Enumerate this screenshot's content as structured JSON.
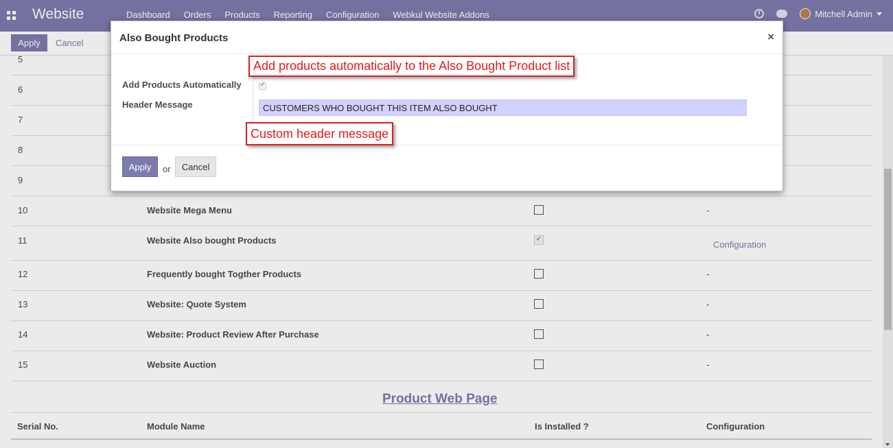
{
  "navbar": {
    "brand": "Website",
    "menu": [
      "Dashboard",
      "Orders",
      "Products",
      "Reporting",
      "Configuration",
      "Webkul Website Addons"
    ],
    "user": "Mitchell Admin"
  },
  "control_panel": {
    "apply_label": "Apply",
    "cancel_label": "Cancel"
  },
  "table": {
    "rows": [
      {
        "num": "5",
        "name": "",
        "installed": null,
        "config": ""
      },
      {
        "num": "6",
        "name": "",
        "installed": null,
        "config": ""
      },
      {
        "num": "7",
        "name": "",
        "installed": null,
        "config": ""
      },
      {
        "num": "8",
        "name": "",
        "installed": null,
        "config": ""
      },
      {
        "num": "9",
        "name": "",
        "installed": null,
        "config": ""
      },
      {
        "num": "10",
        "name": "Website Mega Menu",
        "installed": false,
        "config": "-"
      },
      {
        "num": "11",
        "name": "Website Also bought Products",
        "installed": true,
        "config": "Configuration"
      },
      {
        "num": "12",
        "name": "Frequently bought Togther Products",
        "installed": false,
        "config": "-"
      },
      {
        "num": "13",
        "name": "Website: Quote System",
        "installed": false,
        "config": "-"
      },
      {
        "num": "14",
        "name": "Website: Product Review After Purchase",
        "installed": false,
        "config": "-"
      },
      {
        "num": "15",
        "name": "Website Auction",
        "installed": false,
        "config": "-"
      }
    ],
    "section_title": "Product Web Page",
    "headers": [
      "Serial No.",
      "Module Name",
      "Is Installed ?",
      "Configuration"
    ]
  },
  "modal": {
    "title": "Also Bought Products",
    "close_symbol": "×",
    "fields": {
      "add_auto_label": "Add Products Automatically",
      "add_auto_checked": true,
      "header_message_label": "Header Message",
      "header_message_value": "CUSTOMERS WHO BOUGHT THIS ITEM ALSO BOUGHT"
    },
    "footer": {
      "apply_label": "Apply",
      "or_text": "or",
      "cancel_label": "Cancel"
    }
  },
  "annotations": {
    "auto_note": "Add products automatically to the Also Bought Product list",
    "header_note": "Custom header message"
  },
  "colors": {
    "primary": "#7c7bad",
    "annotation": "#e21b1b",
    "input_highlight": "#d2d2ff"
  }
}
